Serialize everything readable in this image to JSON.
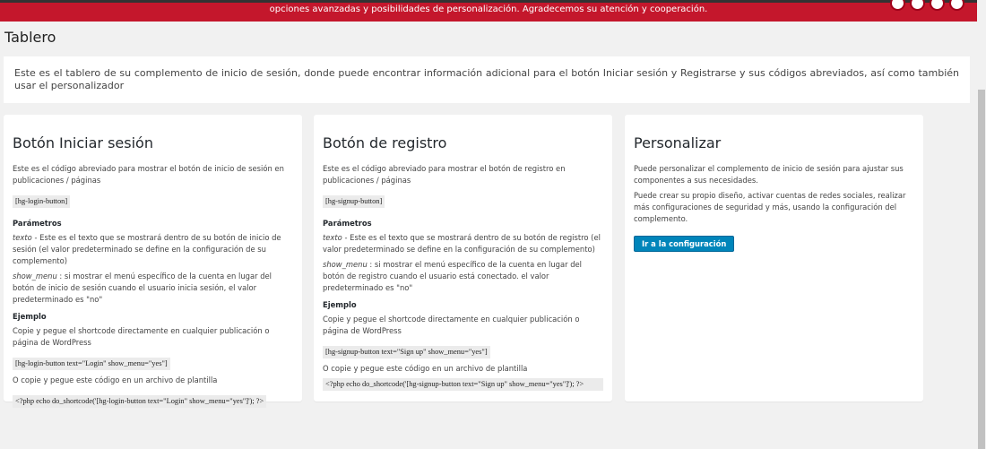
{
  "banner": {
    "text": "opciones avanzadas y posibilidades de personalización. Agradecemos su atención y cooperación."
  },
  "page": {
    "title": "Tablero",
    "intro": "Este es el tablero de su complemento de inicio de sesión, donde puede encontrar información adicional para el botón Iniciar sesión y Registrarse y sus códigos abreviados, así como también usar el personalizador"
  },
  "login_card": {
    "title": "Botón Iniciar sesión",
    "desc": "Este es el código abreviado para mostrar el botón de inicio de sesión en publicaciones / páginas",
    "shortcode": "[hg-login-button]",
    "params_label": "Parámetros",
    "param1_name": "texto",
    "param1_desc": " - Este es el texto que se mostrará dentro de su botón de inicio de sesión (el valor predeterminado se define en la configuración de su complemento)",
    "param2_name": "show_menu",
    "param2_desc": " : si mostrar el menú específico de la cuenta en lugar del botón de inicio de sesión cuando el usuario inicia sesión, el valor predeterminado es \"no\"",
    "example_label": "Ejemplo",
    "example_desc": "Copie y pegue el shortcode directamente en cualquier publicación o página de WordPress",
    "example_code": "[hg-login-button text=\"Login\" show_menu=\"yes\"]",
    "template_desc": "O copie y pegue este código en un archivo de plantilla",
    "template_code": "<?php echo do_shortcode('[hg-login-button text=\"Login\" show_menu=\"yes\"]'); ?>"
  },
  "signup_card": {
    "title": "Botón de registro",
    "desc": "Este es el código abreviado para mostrar el botón de registro en publicaciones / páginas",
    "shortcode": "[hg-signup-button]",
    "params_label": "Parámetros",
    "param1_name": "texto",
    "param1_desc": " - Este es el texto que se mostrará dentro de su botón de registro (el valor predeterminado se define en la configuración de su complemento)",
    "param2_name": "show_menu",
    "param2_desc": " : si mostrar el menú específico de la cuenta en lugar del botón de registro cuando el usuario está conectado. el valor predeterminado es \"no\"",
    "example_label": "Ejemplo",
    "example_desc": "Copie y pegue el shortcode directamente en cualquier publicación o página de WordPress",
    "example_code": "[hg-signup-button text=\"Sign up\" show_menu=\"yes\"]",
    "template_desc": "O copie y pegue este código en un archivo de plantilla",
    "template_code": "<?php echo do_shortcode('[hg-signup-button text=\"Sign up\" show_menu=\"yes\"]'); ?>"
  },
  "customize_card": {
    "title": "Personalizar",
    "desc1": "Puede personalizar el complemento de inicio de sesión para ajustar sus componentes a sus necesidades.",
    "desc2": "Puede crear su propio diseño, activar cuentas de redes sociales, realizar más configuraciones de seguridad y más, usando la configuración del complemento.",
    "button_label": "Ir a la configuración"
  },
  "colors": {
    "banner": "#c4172c",
    "button": "#0085ba"
  }
}
